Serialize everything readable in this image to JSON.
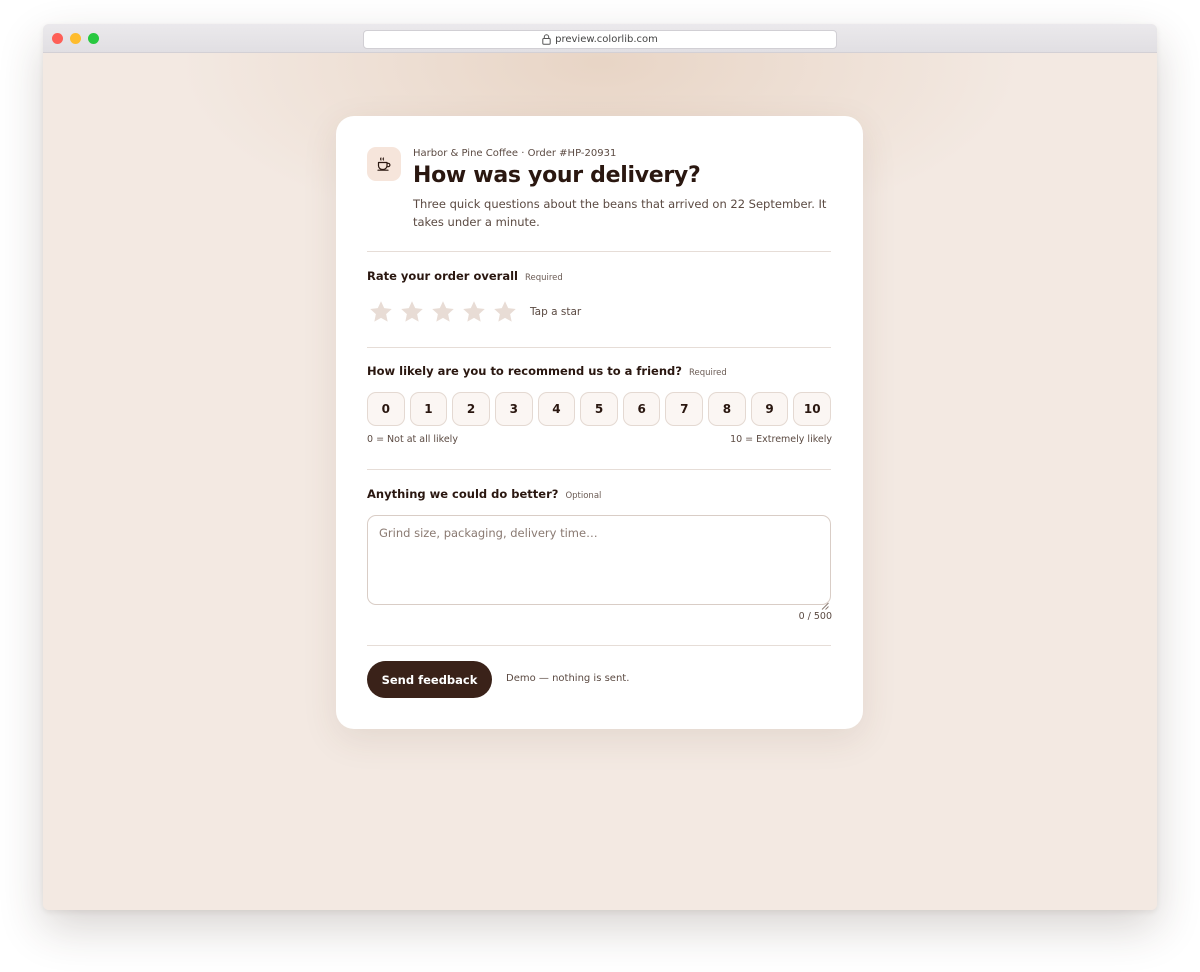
{
  "browser": {
    "url": "preview.colorlib.com"
  },
  "survey": {
    "eyebrow": "Harbor & Pine Coffee · Order #HP-20931",
    "title": "How was your delivery?",
    "description": "Three quick questions about the beans that arrived on 22 September. It takes under a minute.",
    "rating": {
      "label": "Rate your order overall",
      "tag": "Required",
      "hint": "Tap a star",
      "max_stars": 5,
      "selected": 0
    },
    "recommend": {
      "label": "How likely are you to recommend us to a friend?",
      "tag": "Required",
      "scale": [
        "0",
        "1",
        "2",
        "3",
        "4",
        "5",
        "6",
        "7",
        "8",
        "9",
        "10"
      ],
      "low_hint": "0 = Not at all likely",
      "high_hint": "10 = Extremely likely"
    },
    "feedback": {
      "label": "Anything we could do better?",
      "tag": "Optional",
      "placeholder": "Grind size, packaging, delivery time…",
      "value": "",
      "counter": "0 / 500"
    },
    "submit_label": "Send feedback",
    "note": "Demo — nothing is sent."
  },
  "colors": {
    "accent": "#3a2219",
    "background": "#f3e9e2",
    "star_inactive": "#e8dcd5"
  },
  "icons": {
    "logo": "coffee-cup-icon",
    "star": "star-icon",
    "lock": "lock-icon"
  }
}
